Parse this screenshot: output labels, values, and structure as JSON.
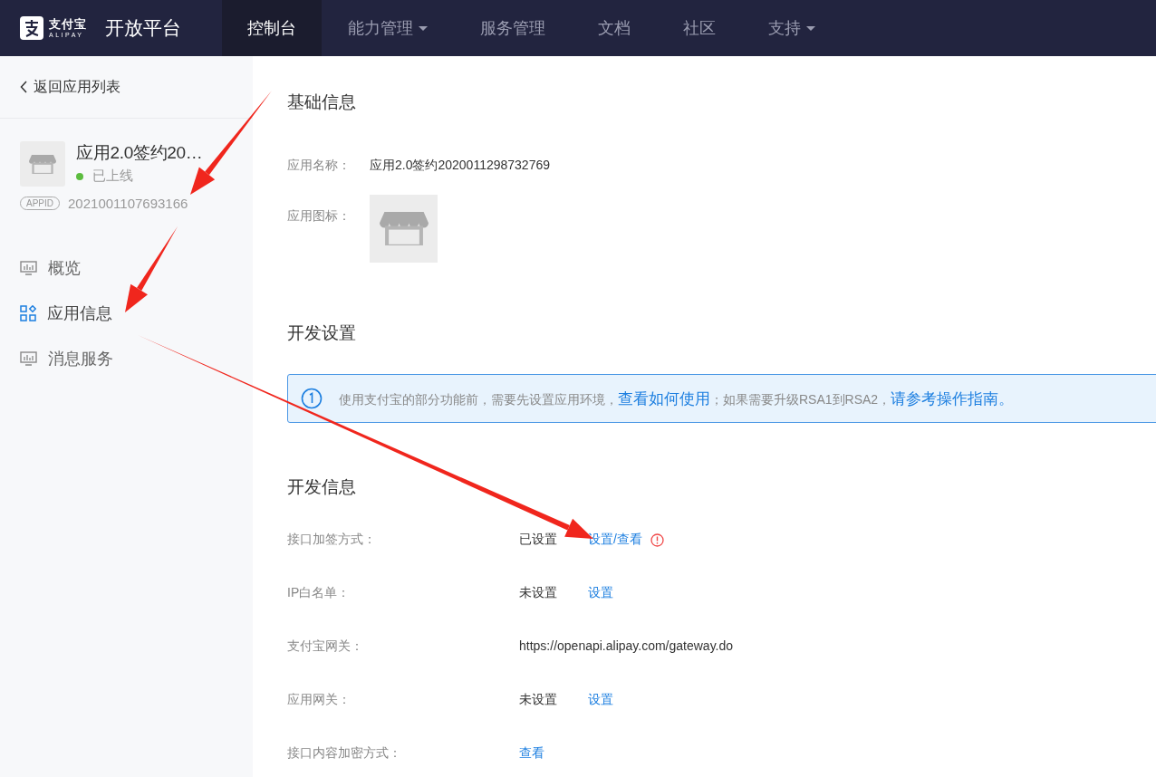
{
  "top_nav": {
    "logo": {
      "brand": "支付宝",
      "brand_latin": "ALIPAY"
    },
    "title": "开放平台",
    "items": [
      {
        "label": "控制台",
        "selected": true,
        "dropdown": false
      },
      {
        "label": "能力管理",
        "selected": false,
        "dropdown": true
      },
      {
        "label": "服务管理",
        "selected": false,
        "dropdown": false
      },
      {
        "label": "文档",
        "selected": false,
        "dropdown": false
      },
      {
        "label": "社区",
        "selected": false,
        "dropdown": false
      },
      {
        "label": "支持",
        "selected": false,
        "dropdown": true
      }
    ]
  },
  "sidebar": {
    "back_link": "返回应用列表",
    "app": {
      "name": "应用2.0签约20…",
      "online": true,
      "status": "已上线",
      "appid_label": "APPID",
      "appid": "2021001107693166"
    },
    "menu": [
      {
        "label": "概览",
        "selected": false
      },
      {
        "label": "应用信息",
        "selected": true
      },
      {
        "label": "消息服务",
        "selected": false
      }
    ]
  },
  "main": {
    "basic_info": {
      "title": "基础信息",
      "rows": [
        {
          "kind": "text",
          "label": "应用名称：",
          "value": "应用2.0签约2020011298732769"
        },
        {
          "kind": "image",
          "label": "应用图标："
        }
      ]
    },
    "dev_settings": {
      "title": "开发设置",
      "alert": [
        {
          "text": "使用支付宝的部分功能前，需要先设置应用环境，",
          "link": false
        },
        {
          "text": "查看如何使用",
          "link": true
        },
        {
          "text": "；如果需要升级RSA1到RSA2，",
          "link": false
        },
        {
          "text": "请参考操作指南。",
          "link": true
        }
      ]
    },
    "dev_info": {
      "title": "开发信息",
      "rows": [
        {
          "label": "接口加签方式：",
          "value": "已设置",
          "action": "设置/查看",
          "warning": true
        },
        {
          "label": "IP白名单：",
          "value": "未设置",
          "action": "设置",
          "warning": false
        },
        {
          "label": "支付宝网关：",
          "value": "https://openapi.alipay.com/gateway.do",
          "warning": false
        },
        {
          "label": "应用网关：",
          "value": "未设置",
          "action": "设置",
          "warning": false
        },
        {
          "label": "接口内容加密方式：",
          "action": "查看",
          "warning": false
        }
      ]
    }
  }
}
